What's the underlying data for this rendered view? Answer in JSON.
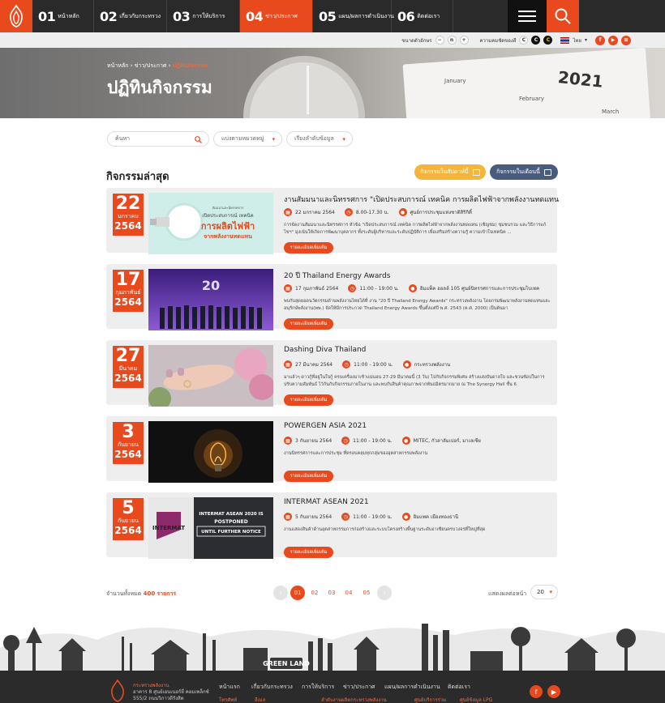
{
  "nav": {
    "items": [
      {
        "num": "01",
        "label": "หน้าหลัก"
      },
      {
        "num": "02",
        "label": "เกี่ยวกับกระทรวง"
      },
      {
        "num": "03",
        "label": "การให้บริการ"
      },
      {
        "num": "04",
        "label": "ข่าว/ประกาศ"
      },
      {
        "num": "05",
        "label": "แผน/ผลการดำเนินงาน"
      },
      {
        "num": "06",
        "label": "ติดต่อเรา"
      }
    ]
  },
  "utility": {
    "text_size_label": "ขนาดตัวอักษร",
    "text_minus": "−",
    "text_normal": "n",
    "text_plus": "+",
    "contrast_label": "ความคมชัดของสี",
    "contrast_c": "C",
    "language": "ไทย"
  },
  "banner": {
    "breadcrumb": [
      "หน้าหลัก",
      "ข่าว/ประกาศ",
      "ปฏิทินกิจกรรม"
    ],
    "separator": "›",
    "title": "ปฏิทินกิจกรรม",
    "cal_year": "2021",
    "cal_months": [
      "January",
      "February",
      "March"
    ]
  },
  "filters": {
    "search_placeholder": "ค้นหา",
    "category": "แบ่งตามหมวดหมู่",
    "sort": "เรียงลำดับข้อมูล"
  },
  "section": {
    "title": "กิจกรรมล่าสุด",
    "week_button": "กิจกรรมในสัปดาห์นี้",
    "month_button": "กิจกรรมในเดือนนี้"
  },
  "events": [
    {
      "day": "22",
      "month": "มกราคม",
      "year": "2564",
      "title": "งานสัมมนาและนิทรรศการ \"เปิดประสบการณ์ เทคนิค การผลิตไฟฟ้าจากพลังงานทดแทน",
      "date": "22 มกราคม 2564",
      "time": "8.00-17.30 น.",
      "place": "ศูนย์การประชุมแห่งชาติสิริกิติ์",
      "desc": "การจัดงานสัมมนาและนิทรรศการ หัวข้อ \"เปิดประสบการณ์ เทคนิค การผลิตไฟฟ้าจากพลังงานทดแทน (เชิญชม) ชุมชนรวม และวิธีการแก้ไขฯ\" มุ่งเน้นให้เกิดการพัฒนาบุคลากร ทั้งระดับผู้บริหารและระดับปฏิบัติการ เพื่อเสริมสร้างความรู้ ความเข้าใจเทคนิค ...",
      "more": "รายละเอียดเพิ่มเติม",
      "thumb_lines": [
        "สัมมนาและนิทรรศการ",
        "เปิดประสบการณ์ เทคนิค",
        "การผลิตไฟฟ้า",
        "จากพลังงานทดแทน"
      ]
    },
    {
      "day": "17",
      "month": "กุมภาพันธ์",
      "year": "2564",
      "title": "20 ปี Thailand Energy Awards",
      "date": "17 กุมภาพันธ์ 2564",
      "time": "11:00 - 19:00 น.",
      "place": "อิมแพ็ค ฮอลล์ 105 ศูนย์นิทรรศการและการประชุมไบเทค",
      "desc": "พบกับสุดยอดนวัตกรรมด้านพลังงานไทยได้ที่ งาน \"20 ปี Thailand Energy Awards\" กระทรวงพลังงาน โดยกรมพัฒนาพลังงานทดแทนและอนุรักษ์พลังงาน(พพ.) จัดให้มีการประกวด Thailand Energy Awards ขึ้นตั้งแต่ปี พ.ศ. 2543 (ค.ศ. 2000) เป็นต้นมา",
      "more": "รายละเอียดเพิ่มเติม",
      "thumb_lines": [
        "20"
      ]
    },
    {
      "day": "27",
      "month": "มีนาคม",
      "year": "2564",
      "title": "Dashing Diva Thailand",
      "date": "27 มีนาคม 2564",
      "time": "11:00 - 19:00 น.",
      "place": "กระทรวงพลังงาน",
      "desc": "มาแล้วๆ ดาวกู้ที่อยู่ในใจกู้ ครบเครื่องมาเช้าแน่นอน 27-29 มีนาคมนี้ (3 วัน) ไปกับกิจกรรมพิเศษ สร้างแสงบันดาลใจ และชวนช้อปในการปรับความสัมพันธ์ ไว้กันกับกิจกรรมภายในงาน และพบกับสินค้าคุณภาพจากพันธมิตรมากมาย ณ The Synergy Hall ชั้น 6",
      "more": "รายละเอียดเพิ่มเติม",
      "thumb_lines": []
    },
    {
      "day": "3",
      "month": "กันยายน",
      "year": "2564",
      "title": "POWERGEN ASIA 2021",
      "date": "3 กันยายน 2564",
      "time": "11:00 - 19:00 น.",
      "place": "MITEC, กัวลาลัมเปอร์, มาเลเซีย",
      "desc": "งานนิทรรศการและการประชุม ที่ครอบคลุมทุกกลุ่มของอุตสาหกรรมพลังงาน",
      "more": "รายละเอียดเพิ่มเติม",
      "thumb_lines": []
    },
    {
      "day": "5",
      "month": "กันยายน",
      "year": "2564",
      "title": "INTERMAT ASEAN 2021",
      "date": "5 กันยายน 2564",
      "time": "11:00 - 19:00 น.",
      "place": "อิมแพค เมืองทองธานี",
      "desc": "งานแสดงสินค้าด้านอุตสาหกรรมการก่อสร้างและระบบโครงสร้างพื้นฐานระดับอาเซียนครบวงจรที่ใหญ่ที่สุด",
      "more": "รายละเอียดเพิ่มเติม",
      "thumb_lines": [
        "INTERMAT ASEAN 2020 IS",
        "POSTPONED",
        "UNTIL FURTHER NOTICE",
        "INTERMAT"
      ]
    }
  ],
  "pagination": {
    "total_label": "จำนวนทั้งหมด",
    "total_count": "400",
    "total_unit": "รายการ",
    "pages": [
      "01",
      "02",
      "03",
      "04",
      "05"
    ],
    "current": "01",
    "prev": "‹",
    "next": "›",
    "per_page_label": "แสดงผลต่อหน้า",
    "per_page": "20"
  },
  "footer": {
    "art_label": "GREEN LAND",
    "org_name": "กระทรวงพลังงาน",
    "address": [
      "อาคาร 8 ศูนย์เอนเนอร์ยี่ คอมเพล็กซ์",
      "555/2 ถนนวิภาวดีรังสิต"
    ],
    "nav": [
      "หน้าแรก",
      "เกี่ยวกับกระทรวง",
      "การให้บริการ",
      "ข่าว/ประกาศ",
      "แผน/ผลการดำเนินงาน",
      "ติดต่อเรา"
    ],
    "sub": [
      "โทรศัพท์",
      "อีเมล",
      "ลำดับงานผลิตกระทรวงพลังงาน",
      "ศูนย์บริการร่วม",
      "ศูนย์ข้อมูล LPG"
    ]
  },
  "colors": {
    "accent": "#e8491d",
    "dark": "#2a2a2a",
    "week_pill": "#f5b53c",
    "month_pill": "#4a5c7d"
  }
}
